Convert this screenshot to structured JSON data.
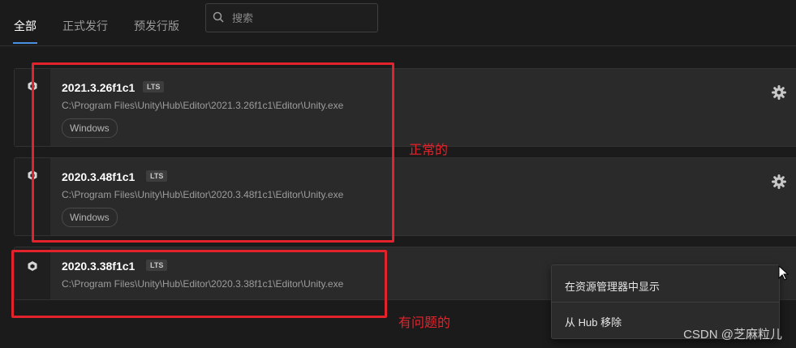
{
  "tabs": [
    {
      "label": "全部",
      "active": true
    },
    {
      "label": "正式发行",
      "active": false
    },
    {
      "label": "预发行版",
      "active": false
    }
  ],
  "search": {
    "placeholder": "搜索",
    "value": ""
  },
  "installs": [
    {
      "version": "2021.3.26f1c1",
      "badge": "LTS",
      "path": "C:\\Program Files\\Unity\\Hub\\Editor\\2021.3.26f1c1\\Editor\\Unity.exe",
      "platform": "Windows",
      "icon": "unity-icon",
      "action_icon": "gear-icon"
    },
    {
      "version": "2020.3.48f1c1",
      "badge": "LTS",
      "path": "C:\\Program Files\\Unity\\Hub\\Editor\\2020.3.48f1c1\\Editor\\Unity.exe",
      "platform": "Windows",
      "icon": "unity-icon",
      "action_icon": "gear-icon"
    },
    {
      "version": "2020.3.38f1c1",
      "badge": "LTS",
      "path": "C:\\Program Files\\Unity\\Hub\\Editor\\2020.3.38f1c1\\Editor\\Unity.exe",
      "platform": "",
      "icon": "unity-icon",
      "action_icon": "gear-icon"
    }
  ],
  "annotations": {
    "normal": "正常的",
    "problem": "有问题的"
  },
  "context_menu": {
    "items": [
      "在资源管理器中显示",
      "从 Hub 移除"
    ]
  },
  "watermark": "CSDN @芝麻粒儿",
  "colors": {
    "background": "#1b1b1b",
    "row": "#2a2a2a",
    "accent": "#4a90e2",
    "annotation_red": "#e3232c"
  }
}
